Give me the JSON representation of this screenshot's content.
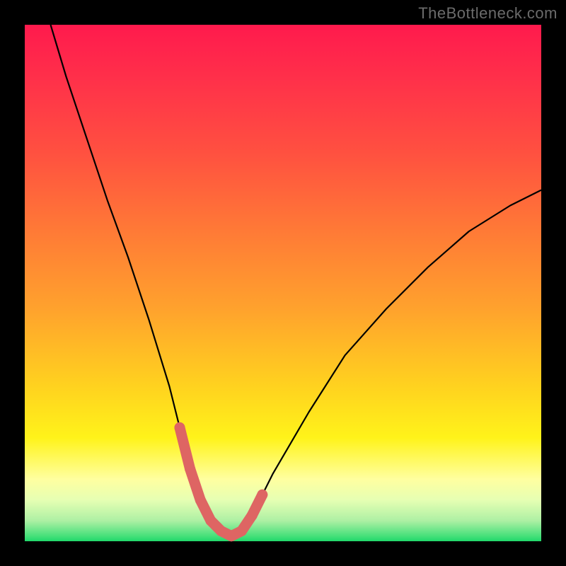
{
  "watermark": "TheBottleneck.com",
  "chart_data": {
    "type": "line",
    "title": "",
    "xlabel": "",
    "ylabel": "",
    "xlim": [
      0,
      100
    ],
    "ylim": [
      0,
      100
    ],
    "series": [
      {
        "name": "bottleneck-curve",
        "x": [
          5,
          8,
          12,
          16,
          20,
          24,
          28,
          30,
          32,
          34,
          36,
          38,
          40,
          42,
          44,
          48,
          55,
          62,
          70,
          78,
          86,
          94,
          100
        ],
        "values": [
          100,
          90,
          78,
          66,
          55,
          43,
          30,
          22,
          14,
          8,
          4,
          2,
          1,
          2,
          5,
          13,
          25,
          36,
          45,
          53,
          60,
          65,
          68
        ]
      }
    ],
    "highlighted_segment": {
      "name": "optimal-zone",
      "x": [
        30,
        32,
        34,
        36,
        38,
        40,
        42,
        44,
        46
      ],
      "values": [
        22,
        14,
        8,
        4,
        2,
        1,
        2,
        5,
        9
      ]
    },
    "gradient_scale": {
      "orientation": "vertical",
      "top_color": "#ff1a4d",
      "bottom_color": "#20d86a",
      "meaning_top": "high-bottleneck",
      "meaning_bottom": "no-bottleneck"
    }
  }
}
